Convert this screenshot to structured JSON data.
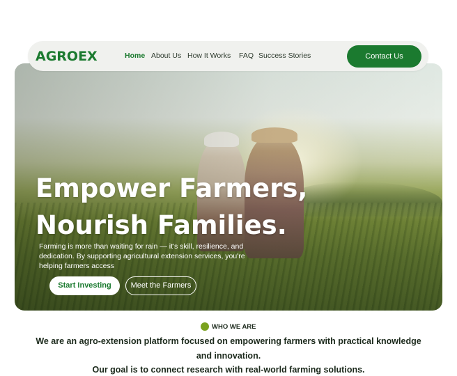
{
  "brand": {
    "name": "AGROEX",
    "color": "#1b7a2f"
  },
  "nav": {
    "items": [
      {
        "label": "Home",
        "active": true
      },
      {
        "label": "About Us",
        "active": false
      },
      {
        "label": "How It Works",
        "active": false
      },
      {
        "label": "FAQ",
        "active": false
      },
      {
        "label": "Success Stories",
        "active": false
      }
    ],
    "contact_label": "Contact Us"
  },
  "hero": {
    "title_line1": "Empower Farmers,",
    "title_line2": "Nourish Families.",
    "subtitle": "Farming is more than waiting for rain — it's skill, resilience, and dedication. By supporting agricultural extension services, you're helping farmers access",
    "primary_cta": "Start Investing",
    "secondary_cta": "Meet the Farmers"
  },
  "about": {
    "badge": "WHO WE ARE",
    "badge_dot_color": "#7aa21f",
    "mission": "We are an agro-extension platform focused on empowering farmers with practical knowledge and innovation.",
    "goal": "Our goal is to connect research with real-world farming solutions."
  }
}
